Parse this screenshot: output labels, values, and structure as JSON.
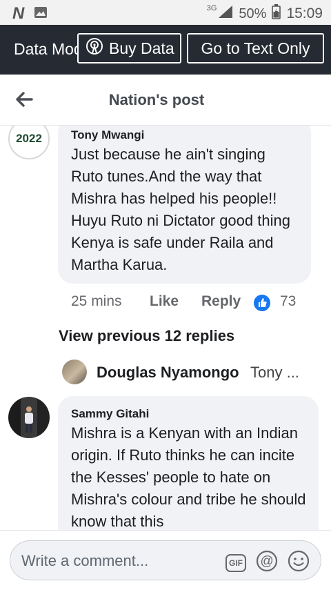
{
  "status_bar": {
    "network": "3G",
    "battery": "50%",
    "time": "15:09"
  },
  "data_bar": {
    "mode_label": "Data Mode",
    "buy_data_label": "Buy Data",
    "text_only_label": "Go to Text Only"
  },
  "header": {
    "title": "Nation's post"
  },
  "comments": [
    {
      "avatar_text": "2022",
      "author": "Tony Mwangi",
      "text": "Just because he ain't singing Ruto tunes.And the way that Mishra has helped his people!! Huyu Ruto ni Dictator good thing Kenya is safe under Raila and Martha Karua.",
      "time": "25 mins",
      "like_label": "Like",
      "reply_label": "Reply",
      "reaction_count": "73"
    },
    {
      "author": "Sammy Gitahi",
      "text": "Mishra is a Kenyan with an Indian origin. If Ruto thinks he can incite the Kesses' people to hate on Mishra's colour and tribe he should know that this"
    }
  ],
  "view_previous": "View previous 12 replies",
  "reply_preview": {
    "name": "Douglas Nyamongo",
    "snippet": "Tony ..."
  },
  "composer": {
    "placeholder": "Write a comment...",
    "gif_label": "GIF"
  },
  "colors": {
    "data_bar_bg": "#252a33",
    "bubble_bg": "#f0f2f5",
    "like_blue": "#1877f2"
  }
}
